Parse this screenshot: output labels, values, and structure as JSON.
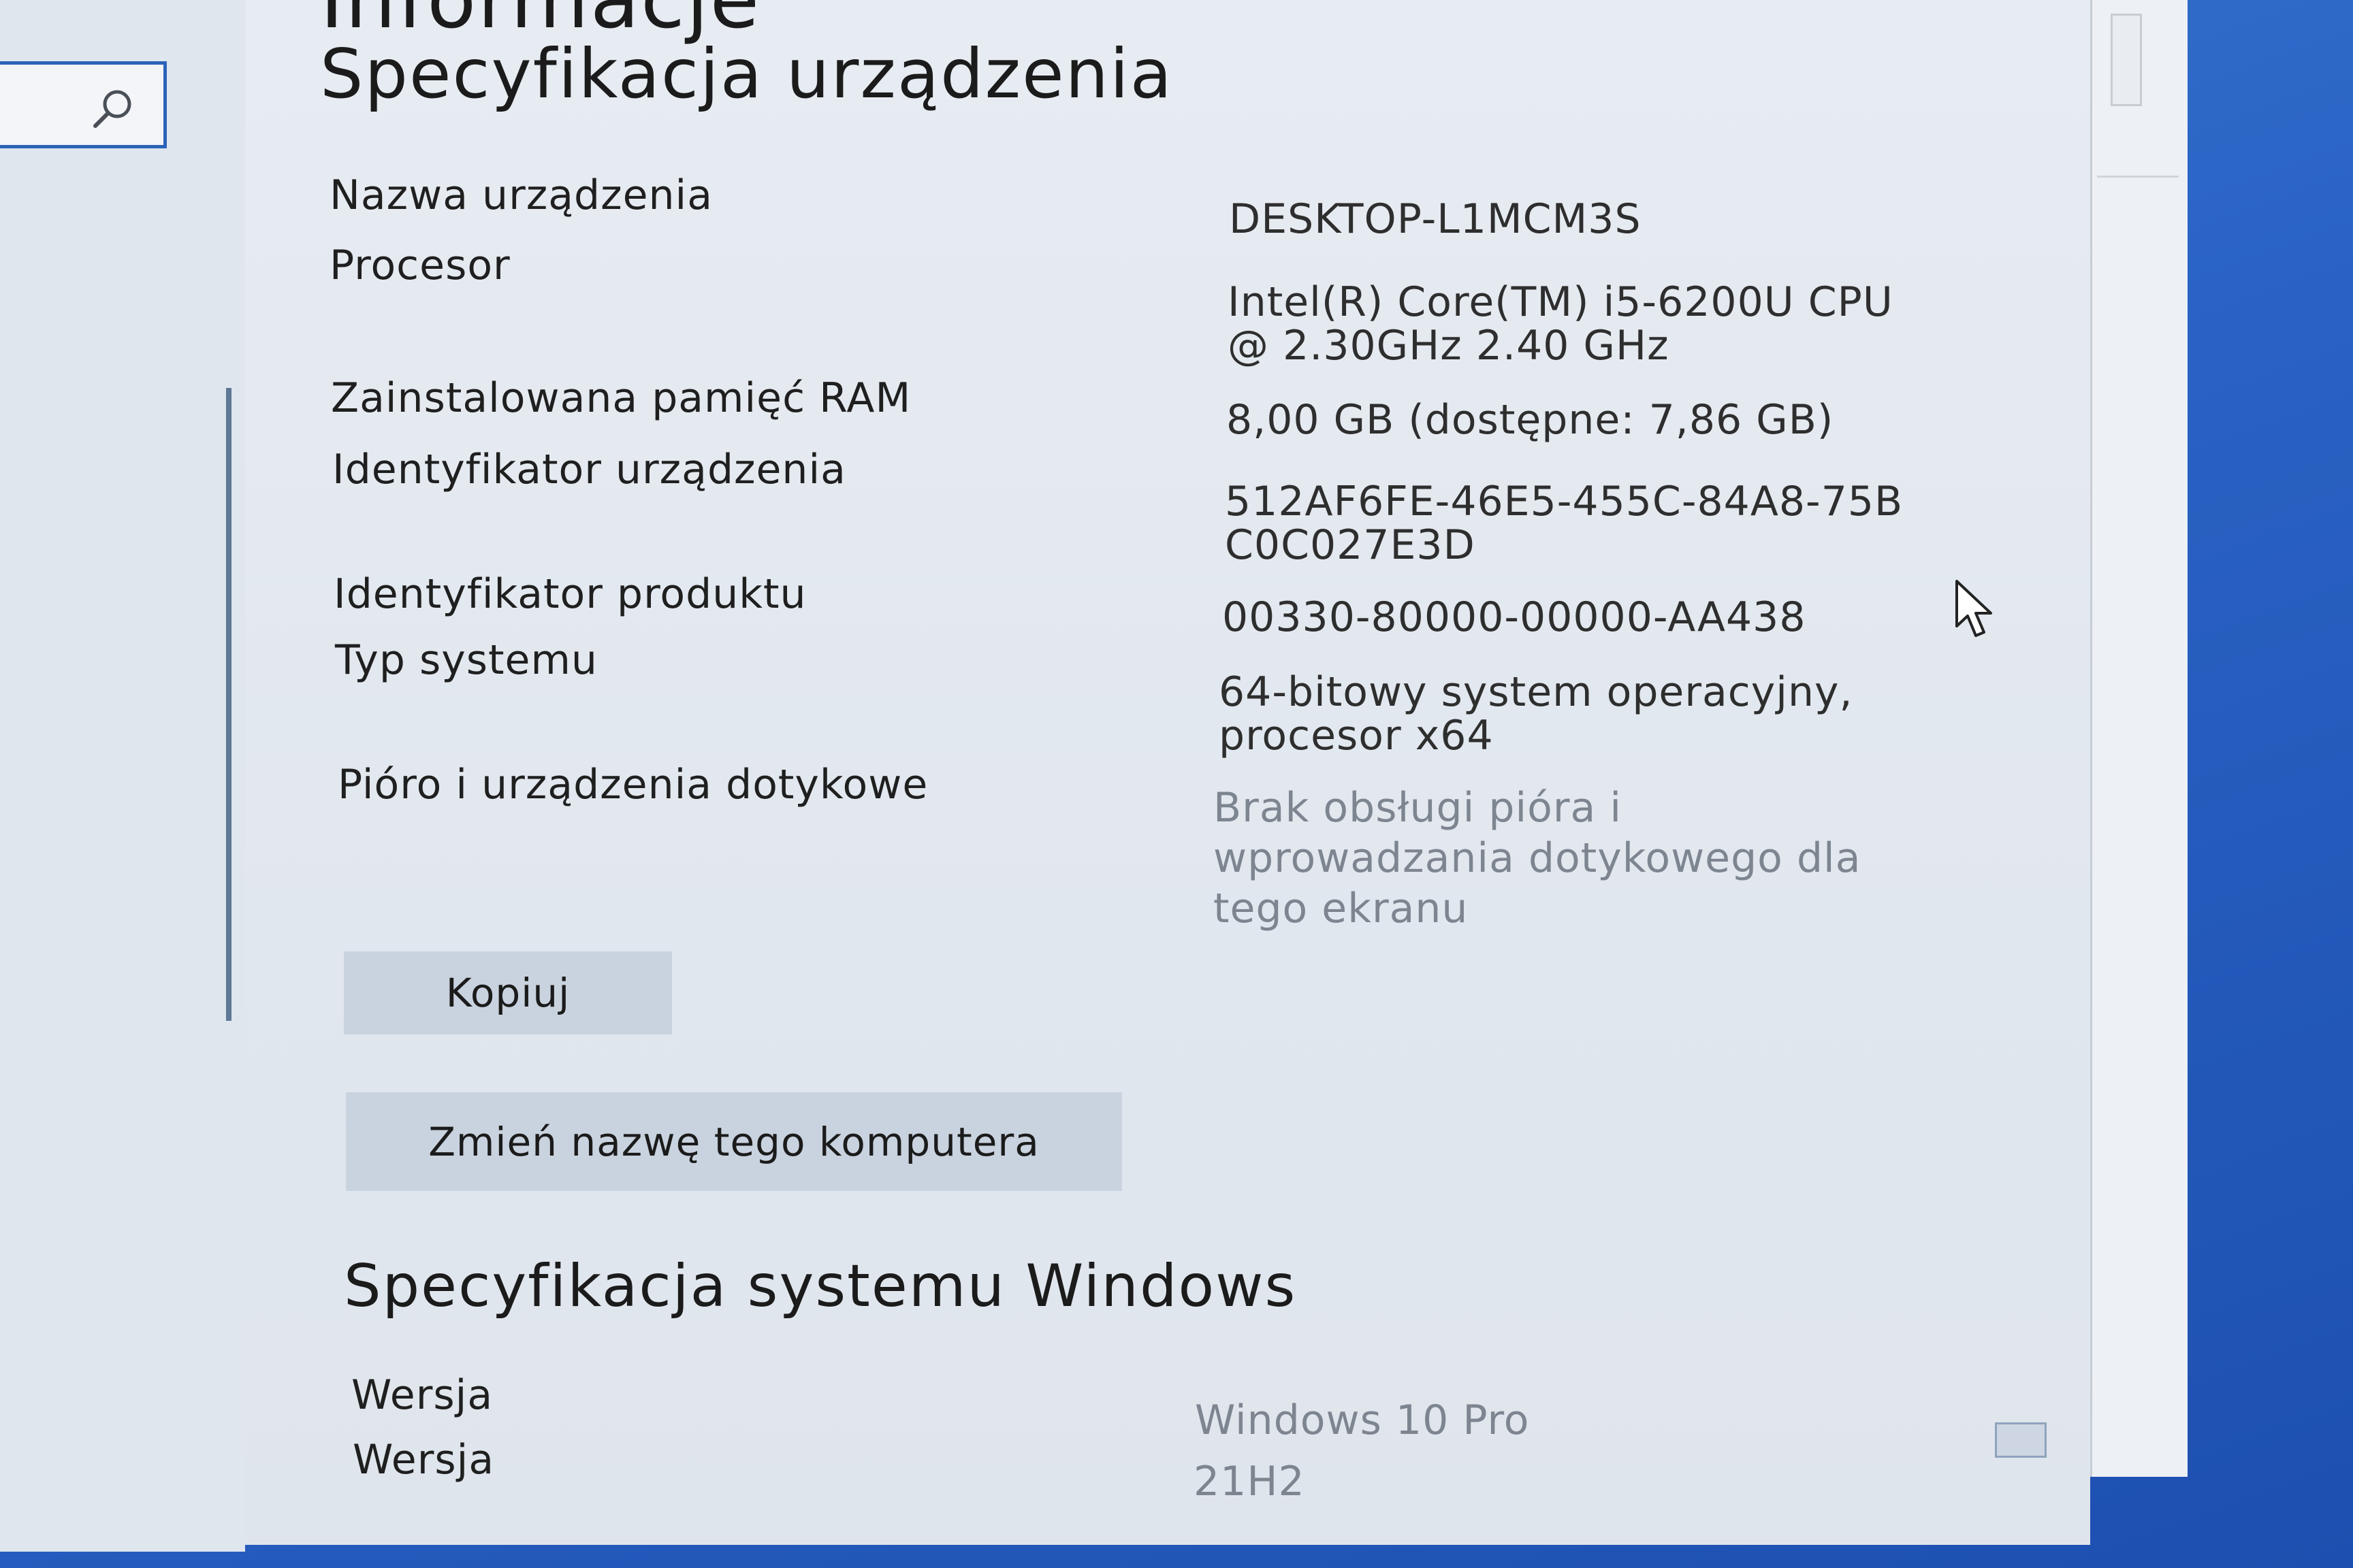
{
  "header": {
    "top_heading_fragment": "Informacje",
    "device_spec_title": "Specyfikacja urządzenia"
  },
  "device_spec": [
    {
      "label": "Nazwa urządzenia",
      "value": [
        "DESKTOP-L1MCM3S"
      ]
    },
    {
      "label": "Procesor",
      "value": [
        "Intel(R) Core(TM) i5-6200U CPU",
        "@ 2.30GHz   2.40 GHz"
      ]
    },
    {
      "label": "Zainstalowana pamięć RAM",
      "value": [
        "8,00 GB (dostępne: 7,86 GB)"
      ]
    },
    {
      "label": "Identyfikator urządzenia",
      "value": [
        "512AF6FE-46E5-455C-84A8-75B",
        "C0C027E3D"
      ]
    },
    {
      "label": "Identyfikator produktu",
      "value": [
        "00330-80000-00000-AA438"
      ]
    },
    {
      "label": "Typ systemu",
      "value": [
        "64-bitowy system operacyjny,",
        "procesor x64"
      ]
    },
    {
      "label": "Pióro i urządzenia dotykowe",
      "value": [
        "Brak obsługi pióra i",
        "wprowadzania dotykowego dla",
        "tego ekranu"
      ]
    }
  ],
  "buttons": {
    "copy_label": "Kopiuj",
    "rename_label": "Zmień nazwę tego komputera"
  },
  "windows_spec": {
    "title": "Specyfikacja systemu Windows",
    "rows": [
      {
        "label": "Wersja",
        "value": "Windows 10 Pro"
      },
      {
        "label": "Wersja",
        "value": "21H2"
      }
    ]
  },
  "icons": {
    "search": "search-icon",
    "cursor": "mouse-cursor-icon",
    "tray": "tray-icon"
  },
  "colors": {
    "accent": "#2b63b8",
    "button_bg": "#c9d3df",
    "desktop_bg": "#2a63c4"
  }
}
